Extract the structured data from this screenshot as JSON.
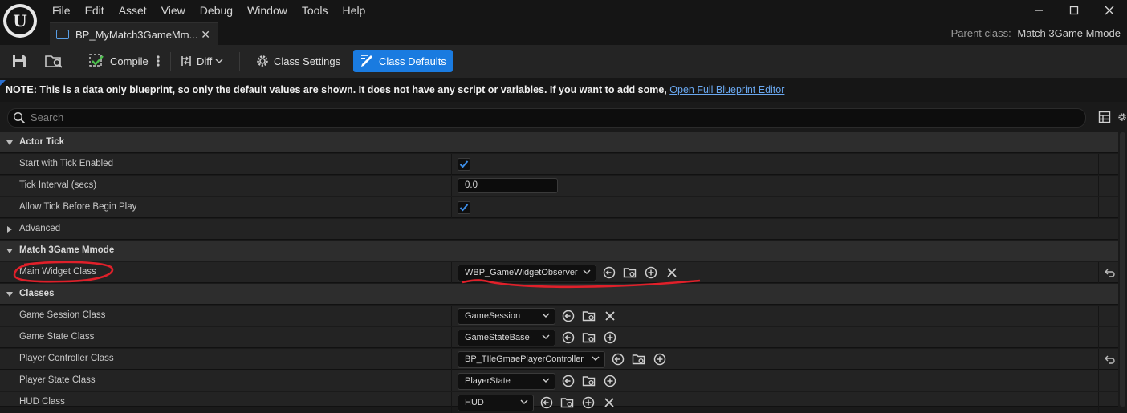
{
  "titlebar": {
    "menu": [
      "File",
      "Edit",
      "Asset",
      "View",
      "Debug",
      "Window",
      "Tools",
      "Help"
    ],
    "tab_title": "BP_MyMatch3GameMm...",
    "parent_class_label": "Parent class:",
    "parent_class_value": "Match 3Game Mmode"
  },
  "toolbar": {
    "compile_label": "Compile",
    "diff_label": "Diff",
    "class_settings_label": "Class Settings",
    "class_defaults_label": "Class Defaults"
  },
  "notice": {
    "text": "NOTE: This is a data only blueprint, so only the default values are shown.  It does not have any script or variables.  If you want to add some, ",
    "link": "Open Full Blueprint Editor"
  },
  "search": {
    "placeholder": "Search"
  },
  "details": {
    "actor_tick": {
      "label": "Actor Tick",
      "start_with_tick_enabled": {
        "label": "Start with Tick Enabled",
        "checked": true
      },
      "tick_interval": {
        "label": "Tick Interval (secs)",
        "value": "0.0"
      },
      "allow_tick_before_begin_play": {
        "label": "Allow Tick Before Begin Play",
        "checked": true
      },
      "advanced_label": "Advanced"
    },
    "match3": {
      "label": "Match 3Game Mmode",
      "main_widget_class": {
        "label": "Main Widget Class",
        "value": "WBP_GameWidgetObserver"
      }
    },
    "classes": {
      "label": "Classes",
      "game_session": {
        "label": "Game Session Class",
        "value": "GameSession"
      },
      "game_state": {
        "label": "Game State Class",
        "value": "GameStateBase"
      },
      "player_controller": {
        "label": "Player Controller Class",
        "value": "BP_TIleGmaePlayerController"
      },
      "player_state": {
        "label": "Player State Class",
        "value": "PlayerState"
      },
      "hud": {
        "label": "HUD Class",
        "value": "HUD"
      }
    }
  },
  "colors": {
    "accent": "#1a7be0",
    "annotation": "#e0202a",
    "checkmark": "#3d8ee8"
  }
}
